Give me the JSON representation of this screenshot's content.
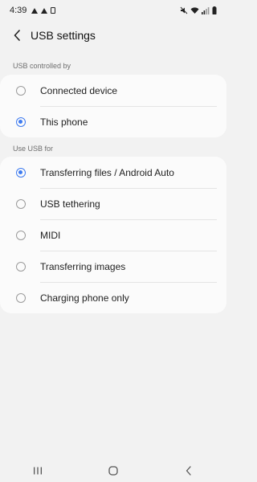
{
  "status_bar": {
    "time": "4:39",
    "icons": [
      "warning-icon",
      "warning-icon",
      "sim-icon",
      "mute-icon",
      "wifi-icon",
      "signal-icon",
      "battery-icon"
    ]
  },
  "header": {
    "title": "USB settings"
  },
  "usb_controlled_by": {
    "label": "USB controlled by",
    "options": [
      {
        "label": "Connected device",
        "selected": false
      },
      {
        "label": "This phone",
        "selected": true
      }
    ]
  },
  "use_usb_for": {
    "label": "Use USB for",
    "options": [
      {
        "label": "Transferring files / Android Auto",
        "selected": true
      },
      {
        "label": "USB tethering",
        "selected": false
      },
      {
        "label": "MIDI",
        "selected": false
      },
      {
        "label": "Transferring images",
        "selected": false
      },
      {
        "label": "Charging phone only",
        "selected": false
      }
    ]
  },
  "nav_bar": {
    "buttons": [
      "recent-apps-icon",
      "home-icon",
      "back-icon"
    ]
  },
  "colors": {
    "accent": "#3e7bf0",
    "background": "#f2f2f2",
    "card": "#fbfbfb"
  }
}
